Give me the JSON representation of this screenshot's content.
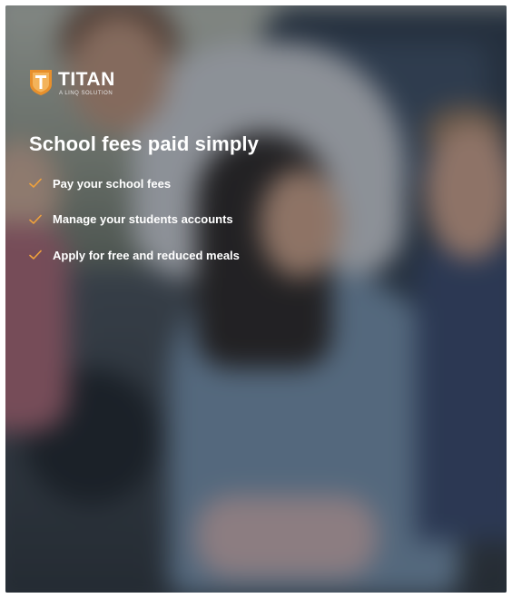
{
  "brand": {
    "name": "TITAN",
    "tagline": "A LINQ SOLUTION",
    "logo_icon": "titan-shield-logo-icon",
    "accent_color": "#e8902c"
  },
  "hero": {
    "headline": "School fees paid simply",
    "background": "blurred photo of parent and children outside a car"
  },
  "features": [
    {
      "icon": "check-icon",
      "label": "Pay your school fees"
    },
    {
      "icon": "check-icon",
      "label": "Manage your students accounts"
    },
    {
      "icon": "check-icon",
      "label": "Apply for free and reduced meals"
    }
  ],
  "colors": {
    "check": "#f0a23c",
    "text": "#ffffff"
  }
}
